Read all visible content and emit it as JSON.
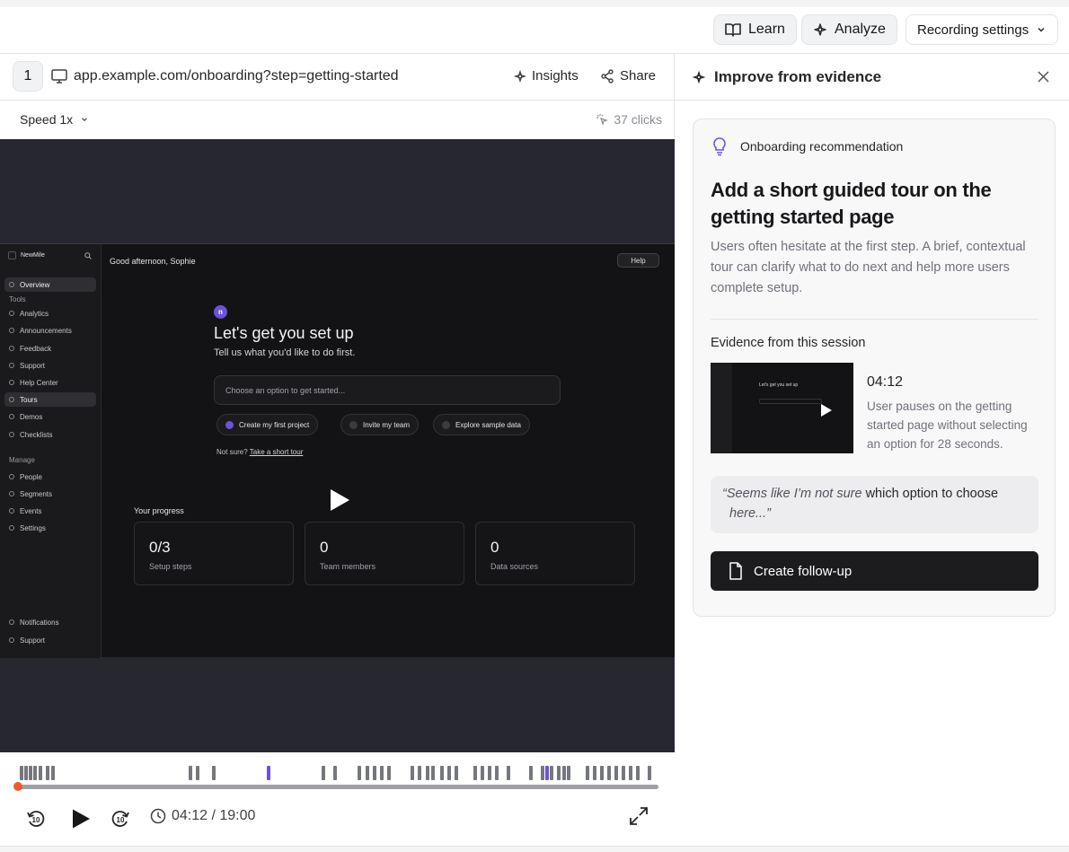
{
  "toolbar": {
    "learn": "Learn",
    "analyze": "Analyze",
    "recording_settings": "Recording settings"
  },
  "session": {
    "index": "1",
    "url": "app.example.com/onboarding?step=getting-started",
    "insights": "Insights",
    "share": "Share",
    "speed": "Speed 1x",
    "clicks": "37 clicks"
  },
  "app": {
    "brand": "NewMile",
    "greeting": "Good afternoon, Sophie",
    "help": "Help",
    "logo_letter": "n",
    "sidebar": {
      "overview": "Overview",
      "section_tools": "Tools",
      "items_tools": [
        "Analytics",
        "Announcements",
        "Feedback",
        "Support",
        "Help Center",
        "Tours",
        "Demos",
        "Checklists"
      ],
      "section_manage": "Manage",
      "items_manage": [
        "People",
        "Segments",
        "Events",
        "Settings"
      ],
      "bottom": [
        "Notifications",
        "Support"
      ]
    },
    "title": "Let's get you set up",
    "subtitle": "Tell us what you'd like to do first.",
    "input_placeholder": "Choose an option to get started...",
    "chips": [
      "Create my first project",
      "Invite my team",
      "Explore sample data"
    ],
    "not_sure": "Not sure?",
    "short_tour": "Take a short tour",
    "progress_label": "Your progress",
    "cards": [
      {
        "value": "0/3",
        "label": "Setup steps"
      },
      {
        "value": "0",
        "label": "Team members"
      },
      {
        "value": "0",
        "label": "Data sources"
      }
    ]
  },
  "player": {
    "time": "04:12 / 19:00",
    "progress_fraction": 0.0
  },
  "panel": {
    "title": "Improve from evidence",
    "tag": "Onboarding recommendation",
    "headline": "Add a short guided tour on the getting started page",
    "description": "Users often hesitate at the first step. A brief, contextual tour can clarify what to do next and help more users complete setup.",
    "evidence_label": "Evidence from this session",
    "timestamp": "04:12",
    "evidence_text": "User pauses on the getting started page without selecting an option for 28 seconds.",
    "quote_a": "“Seems like I’m not sure ",
    "quote_b": "which option to choose",
    "quote_c": "here...”",
    "cta": "Create follow-up",
    "thumb_title": "Let's get you set up"
  },
  "colors": {
    "accent": "#6d52d9",
    "playhead": "#f05a28",
    "cta_bg": "#1c1c1f"
  }
}
